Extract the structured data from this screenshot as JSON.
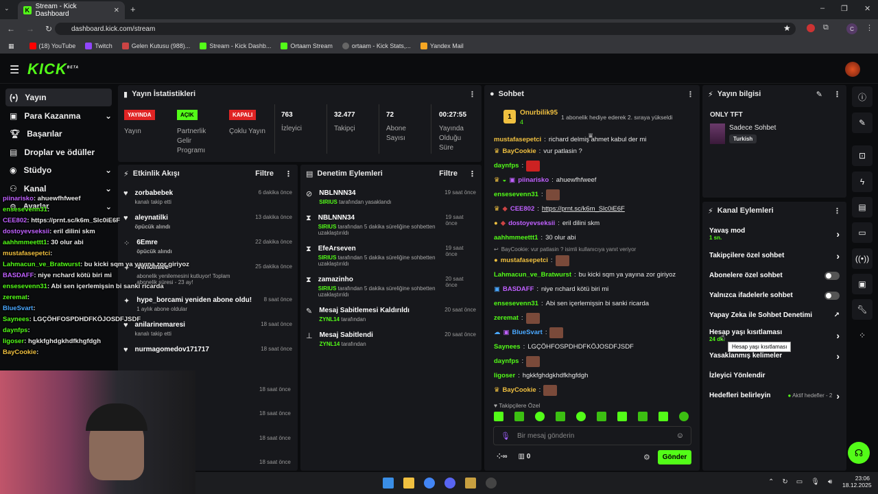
{
  "browser": {
    "tab_title": "Stream - Kick Dashboard",
    "url": "dashboard.kick.com/stream",
    "bookmarks": [
      "(18) YouTube",
      "Twitch",
      "Gelen Kutusu (988)...",
      "Stream - Kick Dashb...",
      "Ortaam Stream",
      "ortaam - Kick Stats,...",
      "Yandex Mail"
    ]
  },
  "brand": {
    "logo": "KICK",
    "beta": "BETA",
    "accent": "#53fc18"
  },
  "sidebar": {
    "items": [
      {
        "label": "Yayın",
        "icon": "broadcast-icon"
      },
      {
        "label": "Para Kazanma",
        "icon": "money-icon"
      },
      {
        "label": "Başarılar",
        "icon": "trophy-icon"
      },
      {
        "label": "Droplar ve ödüller",
        "icon": "gift-icon"
      },
      {
        "label": "Stüdyo",
        "icon": "studio-icon"
      },
      {
        "label": "Kanal",
        "icon": "channel-icon"
      },
      {
        "label": "Ayarlar",
        "icon": "gear-icon"
      }
    ]
  },
  "stats": {
    "title": "Yayın İstatistikleri",
    "items": [
      {
        "badge": "YAYINDA",
        "label": "Yayın",
        "badge_color": "#e02424"
      },
      {
        "badge": "AÇIK",
        "label": "Partnerlik Gelir Programı",
        "badge_color": "#53fc18"
      },
      {
        "badge": "KAPALI",
        "label": "Çoklu Yayın",
        "badge_color": "#e02424"
      },
      {
        "value": "763",
        "label": "İzleyici"
      },
      {
        "value": "32.477",
        "label": "Takipçi"
      },
      {
        "value": "72",
        "label": "Abone Sayısı"
      },
      {
        "value": "00:27:55",
        "label": "Yayında Olduğu Süre"
      }
    ]
  },
  "activity": {
    "title": "Etkinlik Akışı",
    "filter": "Filtre",
    "items": [
      {
        "name": "zorbabebek",
        "sub": "kanalı takip etti",
        "time": "6 dakika önce"
      },
      {
        "name": "aleynatilki",
        "sub": "öpücük alındı",
        "time": "13 dakika önce"
      },
      {
        "name": "6Emre",
        "sub": "öpücük alındı",
        "time": "22 dakika önce"
      },
      {
        "name": "Venomiee",
        "sub": "abonelik yenilemesini kutluyor! Toplam abonelik süresi - 23 ay!",
        "time": "25 dakika önce"
      },
      {
        "name": "hype_borcami yeniden abone oldu!",
        "sub": "1 aylık abone oldular",
        "time": "8 saat önce"
      },
      {
        "name": "anilarinemaresi",
        "sub": "kanalı takip etti",
        "time": "18 saat önce"
      },
      {
        "name": "nurmagomedov171717",
        "sub": "",
        "time": "18 saat önce"
      },
      {
        "name": "",
        "sub": "",
        "time": "18 saat önce"
      },
      {
        "name": "",
        "sub": "",
        "time": "18 saat önce"
      },
      {
        "name": "",
        "sub": "",
        "time": "18 saat önce"
      },
      {
        "name": "",
        "sub": "",
        "time": "18 saat önce"
      }
    ]
  },
  "moderation": {
    "title": "Denetim Eylemleri",
    "filter": "Filtre",
    "items": [
      {
        "name": "NBLNNN34",
        "mod": "SIRIUS",
        "sub": "tarafından yasaklandı",
        "time": "19 saat önce"
      },
      {
        "name": "NBLNNN34",
        "mod": "SIRIUS",
        "sub": "tarafından 5 dakika süreliğine sohbetten uzaklaştırıldı",
        "time": "19 saat önce"
      },
      {
        "name": "EfeArseven",
        "mod": "SIRIUS",
        "sub": "tarafından 5 dakika süreliğine sohbetten uzaklaştırıldı",
        "time": "19 saat önce"
      },
      {
        "name": "zamazinho",
        "mod": "SIRIUS",
        "sub": "tarafından 5 dakika süreliğine sohbetten uzaklaştırıldı",
        "time": "20 saat önce"
      },
      {
        "name": "Mesaj Sabitlemesi Kaldırıldı",
        "mod": "ZYNL14",
        "sub": "tarafından",
        "time": "20 saat önce"
      },
      {
        "name": "Mesaj Sabitlendi",
        "mod": "ZYNL14",
        "sub": "tarafından",
        "time": "20 saat önce"
      }
    ]
  },
  "chat": {
    "title": "Sohbet",
    "pinned_user": "Onurbilik95",
    "pinned_count": "4",
    "pinned_text": "1 abonelik hediye ederek 2. sıraya yükseldi",
    "messages": [
      {
        "user": "mustafasepetci",
        "text": "richard delmiş ahmet kabul der mi",
        "color": "#f0c040"
      },
      {
        "user": "BayCookie",
        "text": "vur patlasin ?",
        "color": "#f0c040"
      },
      {
        "user": "daynfps",
        "text": "",
        "color": "#53fc18"
      },
      {
        "user": "piinarisko",
        "text": "ahuewfhfweef",
        "color": "#c060ff"
      },
      {
        "user": "ensesevenn31",
        "text": "",
        "color": "#53fc18"
      },
      {
        "user": "CEE802",
        "text": "https://prnt.sc/k6m_Slc0iE6F",
        "color": "#c060ff"
      },
      {
        "user": "dostoyevseksii",
        "text": "eril dilini skm",
        "color": "#c060ff"
      },
      {
        "user": "aahhmmeettt1",
        "text": "30 olur abi",
        "color": "#53fc18"
      },
      {
        "user": "mustafasepetci",
        "text": "",
        "color": "#f0c040",
        "reply": "BayCookie: vur patlasin ? isimli kullanıcıya yanıt veriyor"
      },
      {
        "user": "Lahmacun_ve_Bratwurst",
        "text": "bu kicki sqm ya yayına zor giriyoz",
        "color": "#53fc18"
      },
      {
        "user": "BASDAFF",
        "text": "niye rıchard kötü biri mi",
        "color": "#c060ff"
      },
      {
        "user": "ensesevenn31",
        "text": "Abi sen içerlemişsin bi sanki ricarda",
        "color": "#53fc18"
      },
      {
        "user": "zeremat",
        "text": "",
        "color": "#53fc18"
      },
      {
        "user": "BlueSvart",
        "text": "",
        "color": "#4aa8ff"
      },
      {
        "user": "Saynees",
        "text": "LGÇÖHFOSPDHDFKÖJOSDFJSDF",
        "color": "#53fc18"
      },
      {
        "user": "daynfps",
        "text": "",
        "color": "#53fc18"
      },
      {
        "user": "ligoser",
        "text": "hgkkfghdgkhdfkhgfdgh",
        "color": "#53fc18"
      },
      {
        "user": "BayCookie",
        "text": "",
        "color": "#f0c040"
      }
    ],
    "followers_only": "Takipçilere Özel",
    "input_placeholder": "Bir mesaj gönderin",
    "send": "Gönder",
    "points": "∞",
    "store_count": "0"
  },
  "stream_info": {
    "title": "Yayın bilgisi",
    "stream_title": "ONLY TFT",
    "category": "Sadece Sohbet",
    "tag": "Turkish"
  },
  "channel_actions": {
    "title": "Kanal Eylemleri",
    "items": [
      {
        "label": "Yavaş mod",
        "sub": "1 sn.",
        "kind": "arrow"
      },
      {
        "label": "Takipçilere özel sohbet",
        "kind": "arrow"
      },
      {
        "label": "Abonelere özel sohbet",
        "kind": "toggle"
      },
      {
        "label": "Yalnızca ifadelerle sohbet",
        "kind": "toggle"
      },
      {
        "label": "Yapay Zeka ile Sohbet Denetimi",
        "kind": "external"
      },
      {
        "label": "Hesap yaşı kısıtlaması",
        "sub": "24 dk.",
        "kind": "arrow"
      },
      {
        "label": "Yasaklanmış kelimeler",
        "kind": "arrow"
      },
      {
        "label": "İzleyici Yönlendir",
        "kind": "none"
      },
      {
        "label": "Hedefleri belirleyin",
        "sub": "Aktif hedefler - 2",
        "kind": "arrow"
      }
    ],
    "tooltip": "Hesap yaşı kısıtlaması"
  },
  "overlay_chat": [
    {
      "user": "piinarisko",
      "text": ": ahuewfhfweef",
      "color": "#c060ff"
    },
    {
      "user": "ensesevenn31",
      "text": ":",
      "color": "#53fc18"
    },
    {
      "user": "CEE802",
      "text": ": https://prnt.sc/k6m_Slc0iE6F",
      "color": "#c060ff"
    },
    {
      "user": "dostoyevseksii",
      "text": ": eril dilini skm",
      "color": "#c060ff"
    },
    {
      "user": "aahhmmeettt1",
      "text": ": 30 olur abi",
      "color": "#53fc18"
    },
    {
      "user": "mustafasepetci",
      "text": ":",
      "color": "#f0c040"
    },
    {
      "user": "Lahmacun_ve_Bratwurst",
      "text": ": bu kicki sqm ya yayına zor giriyoz",
      "color": "#53fc18"
    },
    {
      "user": "BASDAFF",
      "text": ": niye rıchard kötü biri mi",
      "color": "#c060ff"
    },
    {
      "user": "ensesevenn31",
      "text": ": Abi sen içerlemişsin bi sanki ricarda",
      "color": "#53fc18"
    },
    {
      "user": "zeremat",
      "text": ":",
      "color": "#53fc18"
    },
    {
      "user": "BlueSvart",
      "text": ":",
      "color": "#4aa8ff"
    },
    {
      "user": "Saynees",
      "text": ": LGÇÖHFOSPDHDFKÖJOSDFJSDF",
      "color": "#53fc18"
    },
    {
      "user": "daynfps",
      "text": ":",
      "color": "#53fc18"
    },
    {
      "user": "ligoser",
      "text": ": hgkkfghdgkhdfkhgfdgh",
      "color": "#53fc18"
    },
    {
      "user": "BayCookie",
      "text": ":",
      "color": "#f0c040"
    }
  ],
  "taskbar": {
    "time": "23:06",
    "date": "18.12.2025"
  }
}
